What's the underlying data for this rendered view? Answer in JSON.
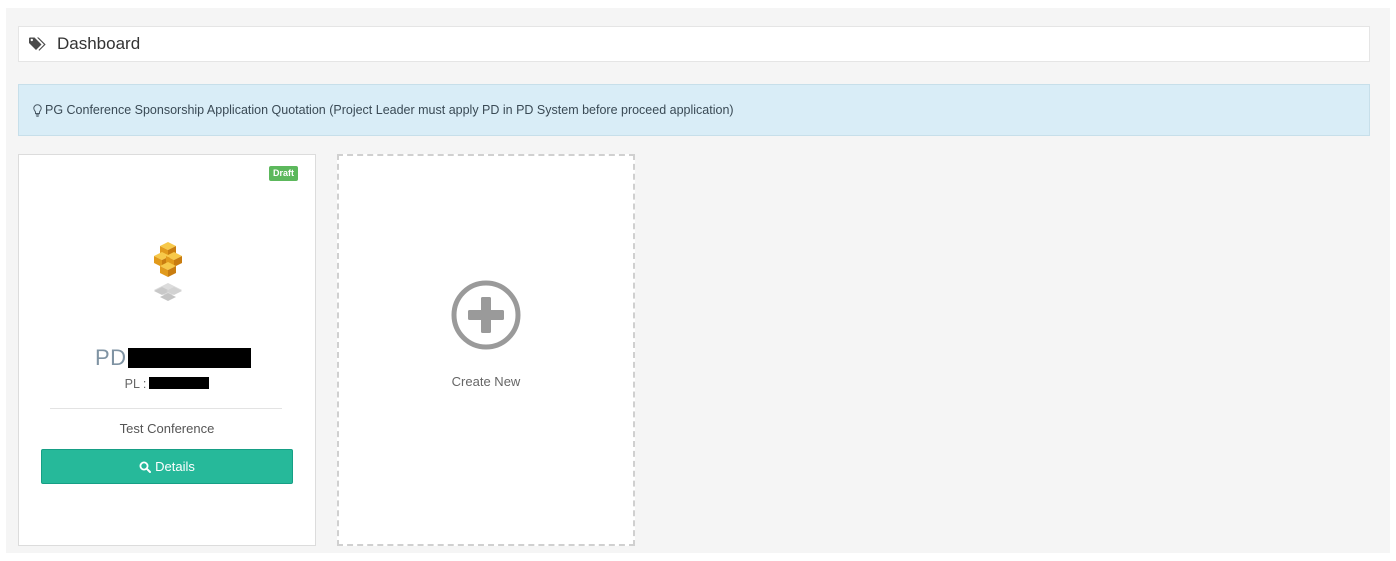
{
  "breadcrumb": {
    "icon": "tags-icon",
    "title": "Dashboard"
  },
  "banner": {
    "icon": "lightbulb-icon",
    "text": "PG Conference Sponsorship Application Quotation (Project Leader must apply PD in PD System before proceed application)"
  },
  "application_card": {
    "status": "Draft",
    "logo": "stacked-boxes-logo",
    "code_prefix": "PD",
    "pl_label": "PL :",
    "title": "Test Conference",
    "details_label": "Details",
    "details_icon": "search-icon"
  },
  "create_card": {
    "icon": "plus-circle-icon",
    "label": "Create New"
  },
  "colors": {
    "page_background": "#f5f5f5",
    "banner_background": "#d9edf7",
    "draft_badge": "#5cb85c",
    "details_button": "#26b99a"
  }
}
